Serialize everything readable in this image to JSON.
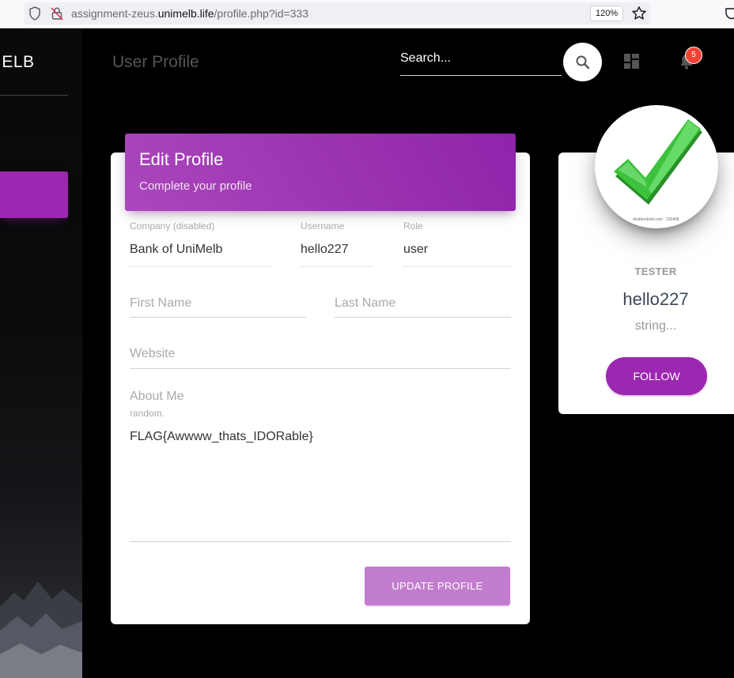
{
  "browser": {
    "url_prefix": "assignment-zeus.",
    "url_host": "unimelb.life",
    "url_path": "/profile.php?id=333",
    "zoom": "120%"
  },
  "sidebar": {
    "brand": "IELB"
  },
  "navbar": {
    "page_title": "User Profile",
    "search_placeholder": "Search...",
    "notification_count": "5"
  },
  "edit_profile": {
    "title": "Edit Profile",
    "subtitle": "Complete your profile",
    "company_label": "Company (disabled)",
    "company_value": "Bank of UniMelb",
    "username_label": "Username",
    "username_value": "hello227",
    "role_label": "Role",
    "role_value": "user",
    "first_name_label": "First Name",
    "last_name_label": "Last Name",
    "website_label": "Website",
    "about_label": "About Me",
    "about_hint": "random.",
    "about_value": "FLAG{Awwww_thats_IDORable}",
    "update_button": "UPDATE PROFILE"
  },
  "profile_card": {
    "avatar_credit": "shutterstock.com · 110406",
    "role": "TESTER",
    "name": "hello227",
    "description": "string...",
    "follow_button": "FOLLOW"
  },
  "colors": {
    "accent": "#9c27b0",
    "button_disabled": "#c27ccd",
    "badge": "#f44336"
  }
}
